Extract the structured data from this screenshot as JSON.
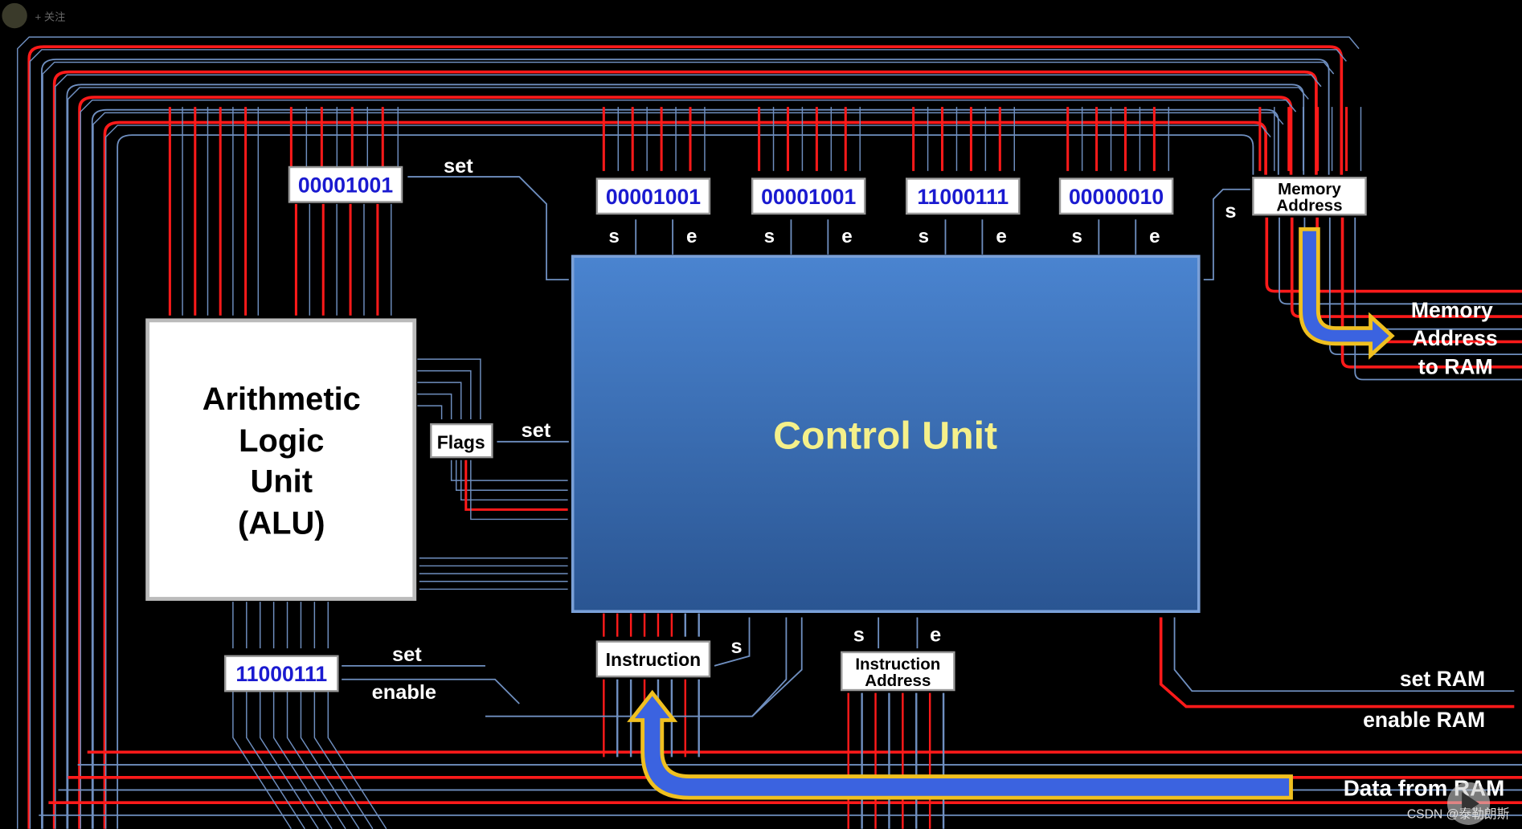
{
  "overlay": {
    "follow_label": "+ 关注",
    "watermark": "CSDN @泰勒朗斯"
  },
  "alu": {
    "lines": [
      "Arithmetic",
      "Logic",
      "Unit",
      "(ALU)"
    ]
  },
  "control_unit": {
    "label": "Control Unit"
  },
  "registers": {
    "tmp": "00001001",
    "acc": "11000111",
    "r0": "00001001",
    "r1": "00001001",
    "r2": "11000111",
    "r3": "00000010"
  },
  "boxes": {
    "flags": "Flags",
    "instruction": "Instruction",
    "instruction_address": [
      "Instruction",
      "Address"
    ],
    "memory_address": [
      "Memory",
      "Address"
    ]
  },
  "labels": {
    "set": "set",
    "enable": "enable",
    "s": "s",
    "e": "e",
    "mar_to_ram": [
      "Memory",
      "Address",
      "to RAM"
    ],
    "set_ram": "set RAM",
    "enable_ram": "enable RAM",
    "data_from_ram": "Data from RAM"
  },
  "colors": {
    "bus_red": "#ff1a1a",
    "control_blue": "#6f8fc0",
    "control_unit_fill": "#3b6db5",
    "register_text": "#1a1ad0",
    "highlight_arrow": "#3b63e0",
    "arrow_outline": "#f0c020",
    "cu_text": "#f5f08a"
  }
}
